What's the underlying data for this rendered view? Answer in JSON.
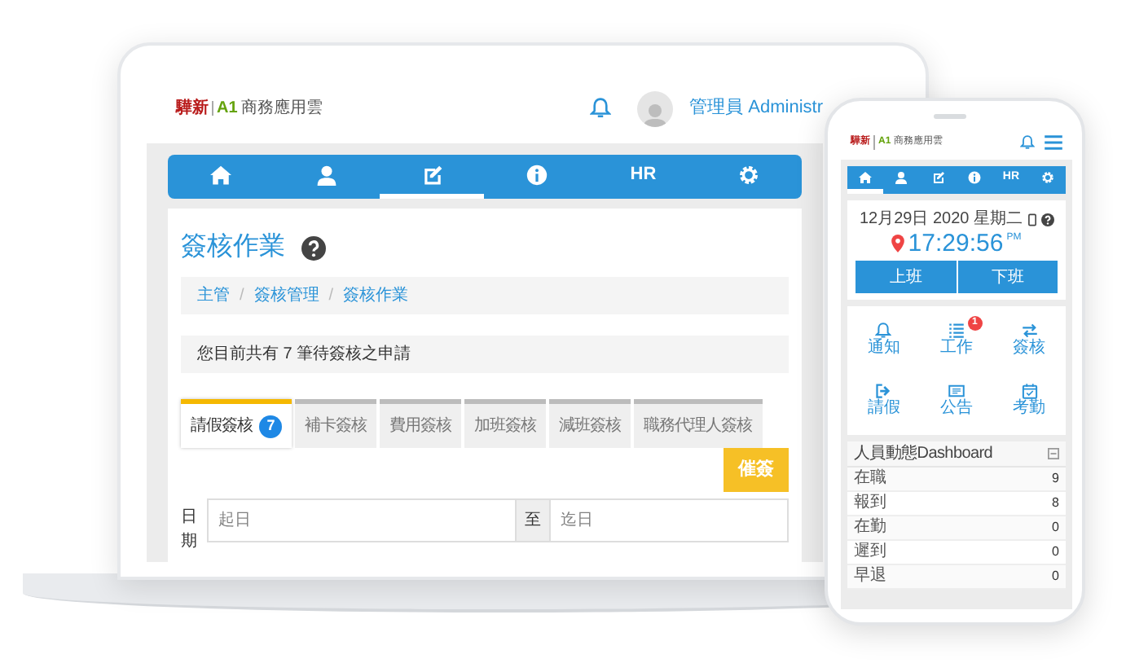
{
  "laptop": {
    "logo": {
      "brand": "驊新",
      "product": "A1",
      "name": "商務應用雲"
    },
    "user": "管理員 Administr",
    "nav": [
      {
        "kind": "home",
        "selected": false
      },
      {
        "kind": "user",
        "selected": false
      },
      {
        "kind": "edit",
        "selected": true
      },
      {
        "kind": "info",
        "selected": false
      },
      {
        "kind": "text",
        "label": "HR",
        "selected": false
      },
      {
        "kind": "gear",
        "selected": false
      }
    ],
    "title": "簽核作業",
    "breadcrumb": [
      "主管",
      "簽核管理",
      "簽核作業"
    ],
    "breadcrumb_separator": "/",
    "notice": "您目前共有 7 筆待簽核之申請",
    "tabs": [
      {
        "label": "請假簽核",
        "badge": "7",
        "selected": true
      },
      {
        "label": "補卡簽核",
        "selected": false
      },
      {
        "label": "費用簽核",
        "selected": false
      },
      {
        "label": "加班簽核",
        "selected": false
      },
      {
        "label": "減班簽核",
        "selected": false
      },
      {
        "label": "職務代理人簽核",
        "selected": false
      }
    ],
    "action_button": "催簽",
    "date_filter": {
      "label": "日期",
      "from_placeholder": "起日",
      "separator": "至",
      "to_placeholder": "迄日"
    }
  },
  "phone": {
    "logo": {
      "brand": "驊新",
      "product": "A1",
      "name": "商務應用雲"
    },
    "nav": [
      {
        "kind": "home",
        "selected": true
      },
      {
        "kind": "user",
        "selected": false
      },
      {
        "kind": "edit",
        "selected": false
      },
      {
        "kind": "info",
        "selected": false
      },
      {
        "kind": "text",
        "label": "HR",
        "selected": false
      },
      {
        "kind": "gear",
        "selected": false
      }
    ],
    "date": "12月29日 2020 星期二",
    "time": "17:29:56",
    "meridiem": "PM",
    "buttons": [
      "上班",
      "下班"
    ],
    "shortcuts": [
      {
        "kind": "bell",
        "label": "通知"
      },
      {
        "kind": "list",
        "label": "工作",
        "badge": "1"
      },
      {
        "kind": "swap",
        "label": "簽核"
      },
      {
        "kind": "exit",
        "label": "請假"
      },
      {
        "kind": "board",
        "label": "公告"
      },
      {
        "kind": "calendar",
        "label": "考勤"
      }
    ],
    "dashboard": {
      "title": "人員動態Dashboard",
      "rows": [
        {
          "label": "在職",
          "value": "9"
        },
        {
          "label": "報到",
          "value": "8"
        },
        {
          "label": "在勤",
          "value": "0"
        },
        {
          "label": "遲到",
          "value": "0"
        },
        {
          "label": "早退",
          "value": "0"
        }
      ]
    }
  }
}
